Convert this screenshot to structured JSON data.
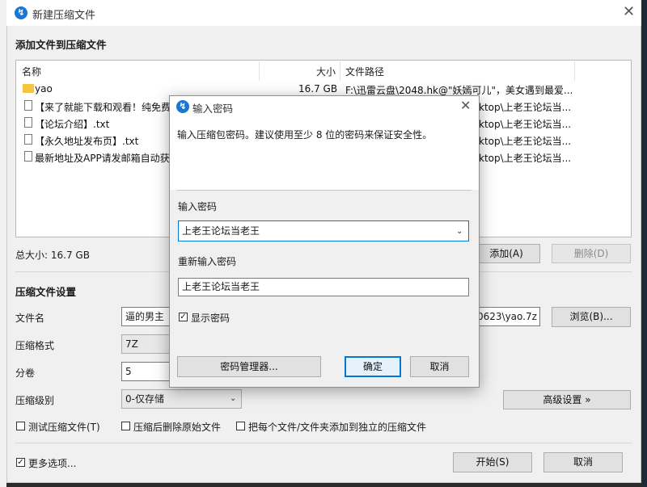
{
  "window": {
    "title": "新建压缩文件"
  },
  "section_add": "添加文件到压缩文件",
  "file_list": {
    "columns": [
      "名称",
      "大小",
      "文件路径"
    ],
    "rows": [
      {
        "name": "yao",
        "size": "16.7 GB",
        "path": "F:\\迅雷云盘\\2048.hk@\"妖嫣可儿\"，美女遇到最爱...",
        "icon": "folder-icon"
      },
      {
        "name": "【来了就能下载和观看！纯免费",
        "size": "",
        "path": "ktop\\上老王论坛当...",
        "icon": "file-icon"
      },
      {
        "name": "【论坛介绍】.txt",
        "size": "",
        "path": "ktop\\上老王论坛当...",
        "icon": "file-icon"
      },
      {
        "name": "【永久地址发布页】.txt",
        "size": "",
        "path": "ktop\\上老王论坛当...",
        "icon": "file-icon"
      },
      {
        "name": "最新地址及APP请发邮箱自动获",
        "size": "",
        "path": "ktop\\上老王论坛当...",
        "icon": "file-icon"
      }
    ]
  },
  "total_size": "总大小: 16.7 GB",
  "buttons": {
    "add": "添加(A)",
    "delete": "删除(D)",
    "browse": "浏览(B)...",
    "advanced": "高级设置 »",
    "start": "开始(S)",
    "cancel": "取消"
  },
  "settings": {
    "heading": "压缩文件设置",
    "filename_label": "文件名",
    "filename_value_left": "逼的男主",
    "filename_value_right": "0623\\yao.7z",
    "format_label": "压缩格式",
    "format_value": "7Z",
    "volume_label": "分卷",
    "volume_value": "5",
    "level_label": "压缩级别",
    "level_value": "0-仅存储"
  },
  "options": {
    "test": "测试压缩文件(T)",
    "delete_after": "压缩后删除原始文件",
    "separate": "把每个文件/文件夹添加到独立的压缩文件",
    "more": "更多选项..."
  },
  "dialog": {
    "title": "输入密码",
    "description": "输入压缩包密码。建议使用至少 8 位的密码来保证安全性。",
    "pw_label": "输入密码",
    "pw_value": "上老王论坛当老王",
    "pw2_label": "重新输入密码",
    "pw2_value": "上老王论坛当老王",
    "show_pw": "显示密码",
    "manager": "密码管理器...",
    "ok": "确定",
    "cancel": "取消"
  },
  "colors": {
    "accent": "#0078d7",
    "app_icon": "#1976d2",
    "folder": "#f5c542"
  }
}
